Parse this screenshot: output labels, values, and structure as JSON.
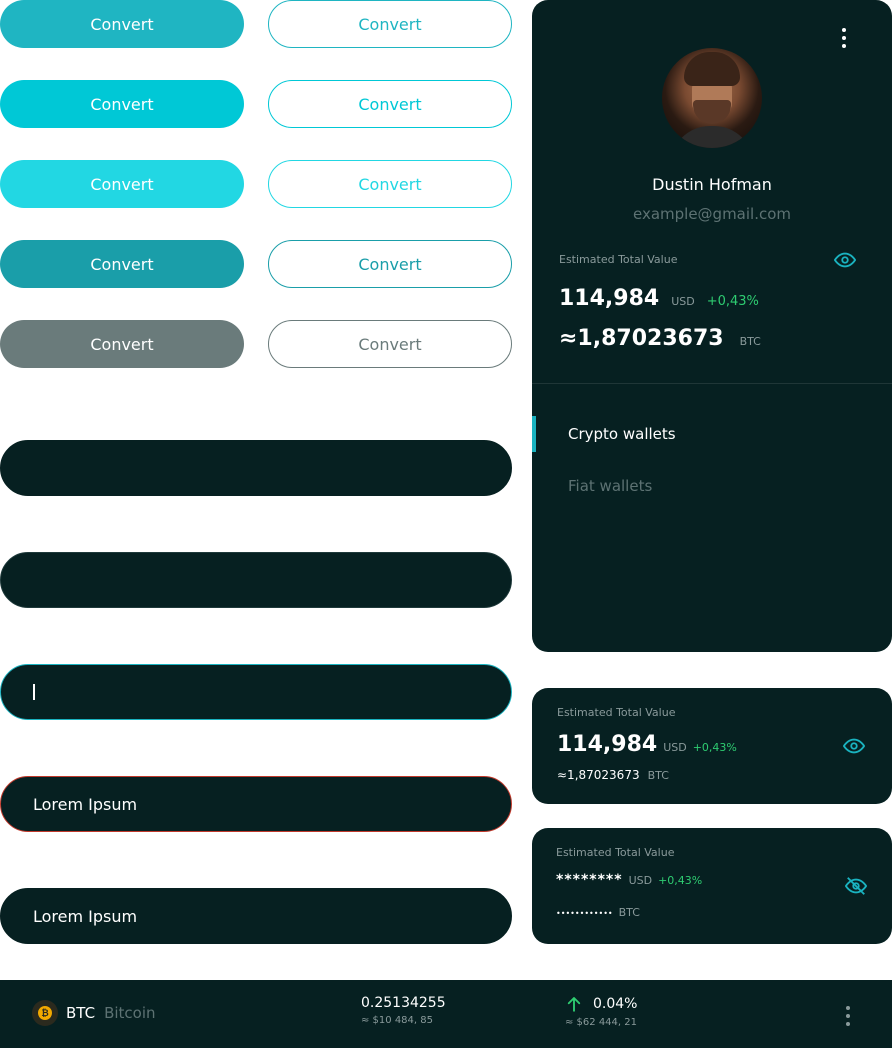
{
  "buttons": {
    "label": "Convert",
    "rows": [
      {
        "filled_color": "#1fb5c2",
        "outline_color": "#1fb5c2",
        "outline_text": "#1fb5c2"
      },
      {
        "filled_color": "#00c8d6",
        "outline_color": "#00c8d6",
        "outline_text": "#00c8d6"
      },
      {
        "filled_color": "#22d7e3",
        "outline_color": "#22d7e3",
        "outline_text": "#22d7e3"
      },
      {
        "filled_color": "#1a9ea9",
        "outline_color": "#1a9ea9",
        "outline_text": "#1a9ea9"
      },
      {
        "filled_color": "#6a7b7b",
        "outline_color": "#6a7b7b",
        "outline_text": "#6a7b7b"
      }
    ]
  },
  "fields": {
    "error_value": "Lorem Ipsum",
    "filled_value": "Lorem Ipsum",
    "focus_color": "#1ab3c0",
    "error_color": "#c0392b"
  },
  "profile": {
    "name": "Dustin Hofman",
    "email": "example@gmail.com",
    "estimated_label": "Estimated Total Value",
    "usd_value": "114,984",
    "usd_unit": "USD",
    "change": "+0,43%",
    "btc_value": "≈1,87023673",
    "btc_unit": "BTC",
    "tabs": [
      {
        "label": "Crypto wallets",
        "active": true
      },
      {
        "label": "Fiat wallets",
        "active": false
      }
    ]
  },
  "card_visible": {
    "estimated_label": "Estimated Total Value",
    "usd_value": "114,984",
    "usd_unit": "USD",
    "change": "+0,43%",
    "btc_value": "≈1,87023673",
    "btc_unit": "BTC"
  },
  "card_hidden": {
    "estimated_label": "Estimated Total Value",
    "usd_value": "********",
    "usd_unit": "USD",
    "change": "+0,43%",
    "btc_value": "••••••••••••",
    "btc_unit": "BTC"
  },
  "asset_row": {
    "symbol": "BTC",
    "name": "Bitcoin",
    "icon": "bitcoin-icon",
    "amount": "0.25134255",
    "amount_fiat": "≈ $10 484, 85",
    "change": "0.04%",
    "price_fiat": "≈ $62 444, 21",
    "trend_icon": "arrow-up-icon",
    "trend_color": "#2ecc71"
  },
  "colors": {
    "panel_bg": "#062021",
    "accent": "#1ab3c0",
    "positive": "#2ecc71"
  }
}
